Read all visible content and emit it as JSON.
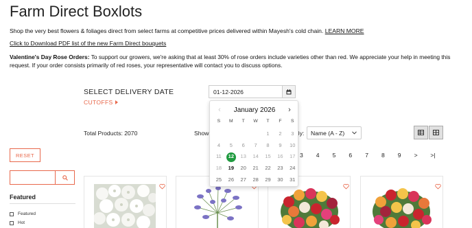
{
  "page": {
    "title": "Farm Direct Boxlots",
    "intro_text": "Shop the very best flowers & foliages direct from select farms at competitive prices delivered within Mayesh's cold chain.",
    "learn_more": "LEARN MORE",
    "pdf_link": "Click to Download PDF list of the new Farm Direct bouquets",
    "notice_label": "Valentine's Day Rose Orders:",
    "notice_text": "To support our growers, we're asking that at least 30% of rose orders include varieties other than red. We appreciate your help in meeting this request. If your order consists primarily of red roses, your representative will contact you to discuss options."
  },
  "delivery": {
    "label": "SELECT DELIVERY DATE",
    "cutoffs": "CUTOFFS",
    "date_value": "01-12-2026"
  },
  "calendar": {
    "month_label": "January 2026",
    "days_of_week": [
      "S",
      "M",
      "T",
      "W",
      "T",
      "F",
      "S"
    ],
    "days": [
      {
        "d": "",
        "s": "empty"
      },
      {
        "d": "",
        "s": "empty"
      },
      {
        "d": "",
        "s": "empty"
      },
      {
        "d": "",
        "s": "empty"
      },
      {
        "d": "1",
        "s": "past"
      },
      {
        "d": "2",
        "s": "past"
      },
      {
        "d": "3",
        "s": "past"
      },
      {
        "d": "4",
        "s": "past"
      },
      {
        "d": "5",
        "s": "past"
      },
      {
        "d": "6",
        "s": "past"
      },
      {
        "d": "7",
        "s": "past"
      },
      {
        "d": "8",
        "s": "past"
      },
      {
        "d": "9",
        "s": "past"
      },
      {
        "d": "10",
        "s": "past"
      },
      {
        "d": "11",
        "s": "past"
      },
      {
        "d": "12",
        "s": "selected"
      },
      {
        "d": "13",
        "s": "disabled"
      },
      {
        "d": "14",
        "s": "disabled"
      },
      {
        "d": "15",
        "s": "disabled"
      },
      {
        "d": "16",
        "s": "disabled"
      },
      {
        "d": "17",
        "s": "disabled"
      },
      {
        "d": "18",
        "s": "disabled"
      },
      {
        "d": "19",
        "s": "bold"
      },
      {
        "d": "20",
        "s": "future"
      },
      {
        "d": "21",
        "s": "future"
      },
      {
        "d": "22",
        "s": "future"
      },
      {
        "d": "23",
        "s": "future"
      },
      {
        "d": "24",
        "s": "future"
      },
      {
        "d": "25",
        "s": "future"
      },
      {
        "d": "26",
        "s": "future"
      },
      {
        "d": "27",
        "s": "future"
      },
      {
        "d": "28",
        "s": "future"
      },
      {
        "d": "29",
        "s": "future"
      },
      {
        "d": "30",
        "s": "future"
      },
      {
        "d": "31",
        "s": "future"
      }
    ]
  },
  "toolbar": {
    "total_products": "Total Products: 2070",
    "show_label": "Show",
    "sort_by_label": "By:",
    "sort_value": "Name (A - Z)"
  },
  "pagination": [
    "3",
    "4",
    "5",
    "6",
    "7",
    "8",
    "9",
    ">",
    ">|"
  ],
  "sidebar": {
    "reset_label": "RESET",
    "featured_heading": "Featured",
    "options": [
      "Featured",
      "Hot"
    ]
  },
  "colors": {
    "accent": "#e8674a",
    "selected_date": "#1f9a3f"
  }
}
